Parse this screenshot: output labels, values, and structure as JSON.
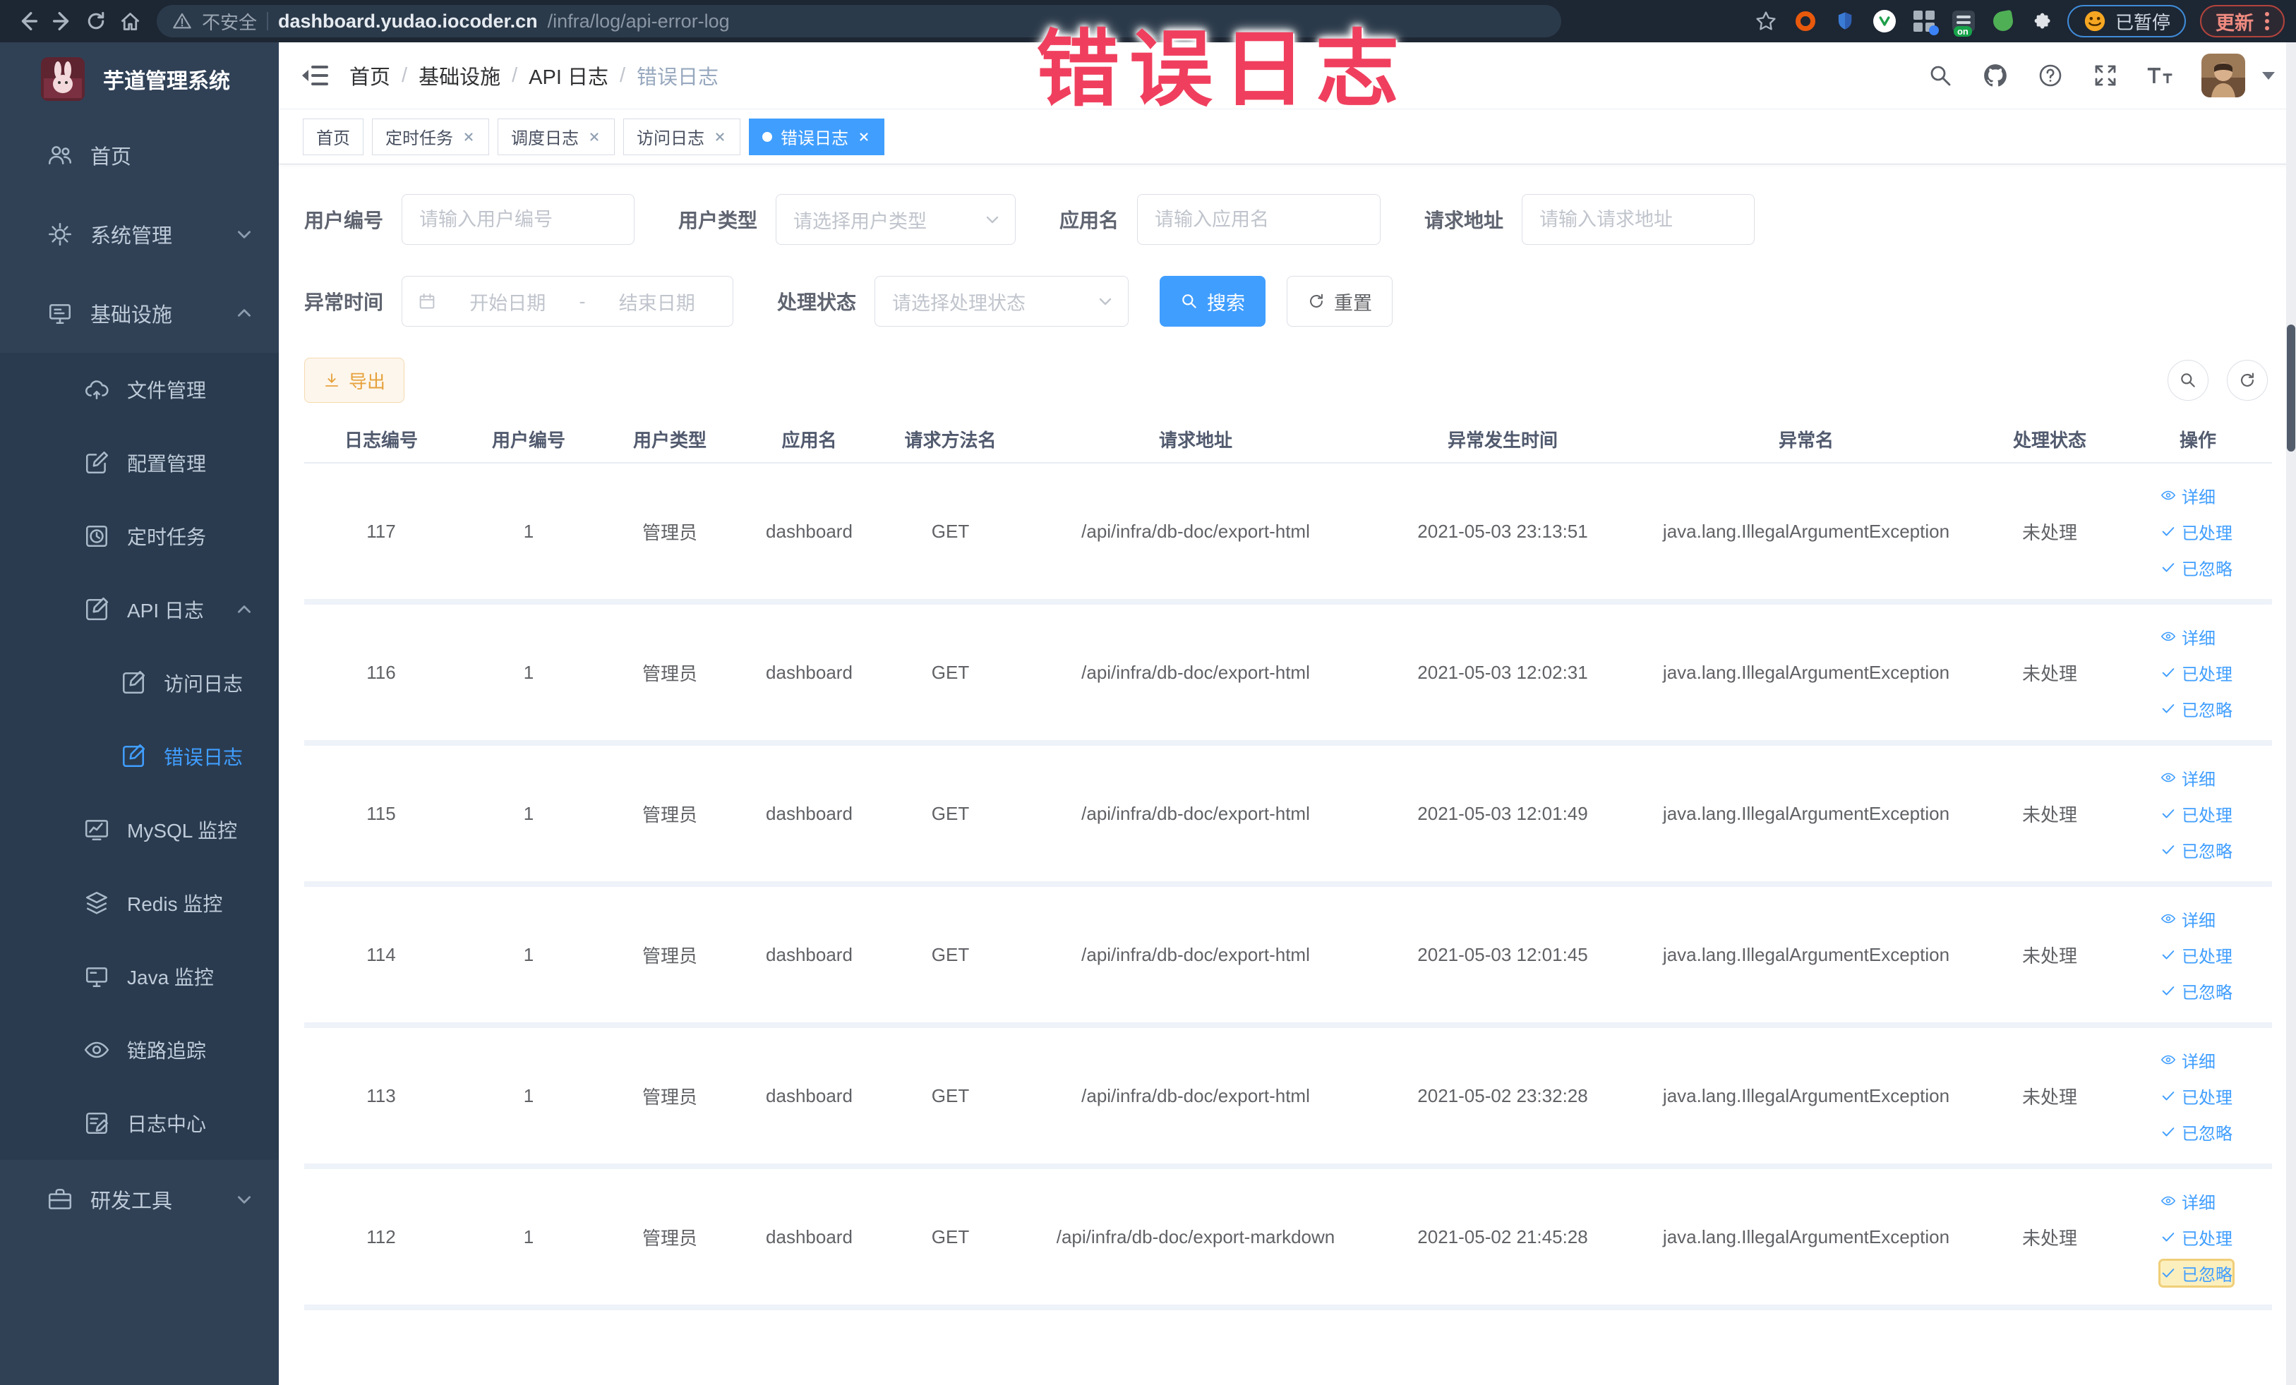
{
  "browser": {
    "security_label": "不安全",
    "url_domain": "dashboard.yudao.iocoder.cn",
    "url_path": "/infra/log/api-error-log",
    "on_badge": "on",
    "paused_badge": "已暂停",
    "update_button": "更新"
  },
  "annotation": {
    "text": "错误日志"
  },
  "sidebar": {
    "logo_title": "芋道管理系统",
    "items": [
      {
        "label": "首页"
      },
      {
        "label": "系统管理"
      },
      {
        "label": "基础设施"
      },
      {
        "label": "文件管理"
      },
      {
        "label": "配置管理"
      },
      {
        "label": "定时任务"
      },
      {
        "label": "API 日志"
      },
      {
        "label": "访问日志"
      },
      {
        "label": "错误日志"
      },
      {
        "label": "MySQL 监控"
      },
      {
        "label": "Redis 监控"
      },
      {
        "label": "Java 监控"
      },
      {
        "label": "链路追踪"
      },
      {
        "label": "日志中心"
      },
      {
        "label": "研发工具"
      }
    ]
  },
  "navbar": {
    "breadcrumb": [
      "首页",
      "基础设施",
      "API 日志",
      "错误日志"
    ],
    "separator": "/"
  },
  "tabs": [
    {
      "label": "首页"
    },
    {
      "label": "定时任务"
    },
    {
      "label": "调度日志"
    },
    {
      "label": "访问日志"
    },
    {
      "label": "错误日志"
    }
  ],
  "filters": {
    "user_id": {
      "label": "用户编号",
      "placeholder": "请输入用户编号"
    },
    "user_type": {
      "label": "用户类型",
      "placeholder": "请选择用户类型"
    },
    "app_name": {
      "label": "应用名",
      "placeholder": "请输入应用名"
    },
    "request_url": {
      "label": "请求地址",
      "placeholder": "请输入请求地址"
    },
    "exception_time": {
      "label": "异常时间",
      "start_placeholder": "开始日期",
      "separator": "-",
      "end_placeholder": "结束日期"
    },
    "process_status": {
      "label": "处理状态",
      "placeholder": "请选择处理状态"
    },
    "search_button": "搜索",
    "reset_button": "重置"
  },
  "toolbar": {
    "export_button": "导出"
  },
  "table": {
    "columns": [
      "日志编号",
      "用户编号",
      "用户类型",
      "应用名",
      "请求方法名",
      "请求地址",
      "异常发生时间",
      "异常名",
      "处理状态",
      "操作"
    ],
    "actions": {
      "detail": "详细",
      "processed": "已处理",
      "ignored": "已忽略"
    },
    "rows": [
      {
        "id": "117",
        "user_id": "1",
        "user_type": "管理员",
        "app": "dashboard",
        "method": "GET",
        "url": "/api/infra/db-doc/export-html",
        "time": "2021-05-03 23:13:51",
        "exception": "java.lang.IllegalArgumentException",
        "status": "未处理"
      },
      {
        "id": "116",
        "user_id": "1",
        "user_type": "管理员",
        "app": "dashboard",
        "method": "GET",
        "url": "/api/infra/db-doc/export-html",
        "time": "2021-05-03 12:02:31",
        "exception": "java.lang.IllegalArgumentException",
        "status": "未处理"
      },
      {
        "id": "115",
        "user_id": "1",
        "user_type": "管理员",
        "app": "dashboard",
        "method": "GET",
        "url": "/api/infra/db-doc/export-html",
        "time": "2021-05-03 12:01:49",
        "exception": "java.lang.IllegalArgumentException",
        "status": "未处理"
      },
      {
        "id": "114",
        "user_id": "1",
        "user_type": "管理员",
        "app": "dashboard",
        "method": "GET",
        "url": "/api/infra/db-doc/export-html",
        "time": "2021-05-03 12:01:45",
        "exception": "java.lang.IllegalArgumentException",
        "status": "未处理"
      },
      {
        "id": "113",
        "user_id": "1",
        "user_type": "管理员",
        "app": "dashboard",
        "method": "GET",
        "url": "/api/infra/db-doc/export-html",
        "time": "2021-05-02 23:32:28",
        "exception": "java.lang.IllegalArgumentException",
        "status": "未处理"
      },
      {
        "id": "112",
        "user_id": "1",
        "user_type": "管理员",
        "app": "dashboard",
        "method": "GET",
        "url": "/api/infra/db-doc/export-markdown",
        "time": "2021-05-02 21:45:28",
        "exception": "java.lang.IllegalArgumentException",
        "status": "未处理"
      }
    ]
  }
}
